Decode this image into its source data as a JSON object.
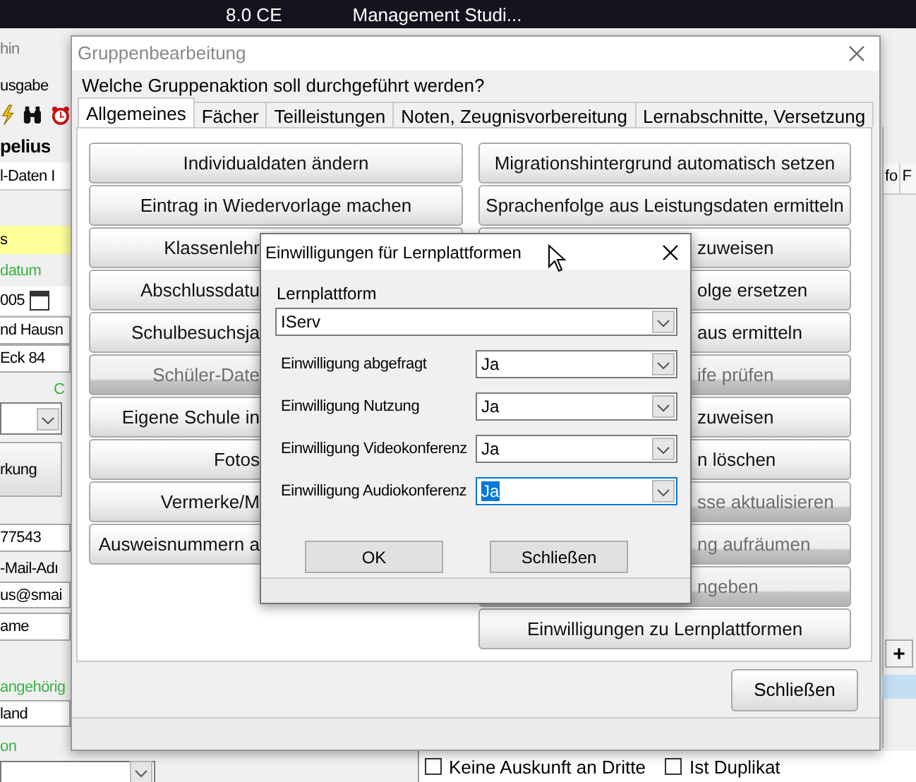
{
  "app": {
    "title_version": "8.0 CE",
    "title_app": "Management Studi...",
    "strip": [
      {
        "kind": "menu",
        "text": "hin"
      },
      {
        "kind": "text",
        "text": "usgabe"
      },
      {
        "kind": "icons"
      },
      {
        "kind": "bold",
        "text": "pelius"
      },
      {
        "kind": "tab",
        "text": "l-Daten I"
      },
      {
        "kind": "yellow",
        "text": "s"
      },
      {
        "kind": "green",
        "text": "datum"
      },
      {
        "kind": "date",
        "text": "005"
      },
      {
        "kind": "field",
        "text": "nd Hausn"
      },
      {
        "kind": "field",
        "text": "Eck 84"
      },
      {
        "kind": "greenright",
        "text": "C"
      },
      {
        "kind": "combo"
      },
      {
        "kind": "button",
        "text": "rkung"
      },
      {
        "kind": "field",
        "text": "77543"
      },
      {
        "kind": "text",
        "text": "-Mail-Adı"
      },
      {
        "kind": "field",
        "text": "us@smai"
      },
      {
        "kind": "field",
        "text": "ame"
      },
      {
        "kind": "green",
        "text": "angehörig"
      },
      {
        "kind": "field",
        "text": "land"
      },
      {
        "kind": "green",
        "text": "on"
      },
      {
        "kind": "widecombo"
      }
    ],
    "side_tabs": [
      "fo",
      "F"
    ],
    "add_button": "+",
    "checkboxes": [
      {
        "label": "Keine Auskunft an Dritte",
        "checked": false
      },
      {
        "label": "Ist Duplikat",
        "checked": false
      }
    ]
  },
  "dialog": {
    "title": "Gruppenbearbeitung",
    "prompt": "Welche Gruppenaktion soll durchgeführt werden?",
    "tabs": [
      {
        "label": "Allgemeines",
        "selected": true
      },
      {
        "label": "Fächer",
        "selected": false
      },
      {
        "label": "Teilleistungen",
        "selected": false
      },
      {
        "label": "Noten, Zeugnisvorbereitung",
        "selected": false
      },
      {
        "label": "Lernabschnitte, Versetzung",
        "selected": false
      }
    ],
    "left_buttons": [
      {
        "label": "Individualdaten ändern",
        "disabled": false
      },
      {
        "label": "Eintrag in Wiedervorlage machen",
        "disabled": false
      },
      {
        "label": "Klassenlehr",
        "disabled": false
      },
      {
        "label": "Abschlussdatu",
        "disabled": false
      },
      {
        "label": "Schulbesuchsja",
        "disabled": false
      },
      {
        "label": "Schüler-Date",
        "disabled": true
      },
      {
        "label": "Eigene Schule in",
        "disabled": false
      },
      {
        "label": "Fotos",
        "disabled": false
      },
      {
        "label": "Vermerke/M",
        "disabled": false
      },
      {
        "label": "Ausweisnummern a",
        "disabled": false
      }
    ],
    "right_buttons": [
      {
        "label": "Migrationshintergrund automatisch setzen",
        "disabled": false
      },
      {
        "label": "Sprachenfolge aus Leistungsdaten ermitteln",
        "disabled": false
      },
      {
        "label": "zuweisen",
        "disabled": false
      },
      {
        "label": "olge ersetzen",
        "disabled": false
      },
      {
        "label": "aus ermitteln",
        "disabled": false
      },
      {
        "label": "ife prüfen",
        "disabled": true
      },
      {
        "label": "zuweisen",
        "disabled": false
      },
      {
        "label": "n löschen",
        "disabled": false
      },
      {
        "label": "sse aktualisieren",
        "disabled": true
      },
      {
        "label": "ng aufräumen",
        "disabled": true
      },
      {
        "label": "ngeben",
        "disabled": true
      },
      {
        "label": "Einwilligungen zu Lernplattformen",
        "disabled": false
      }
    ],
    "close_button": "Schließen"
  },
  "consent_dialog": {
    "title": "Einwilligungen für Lernplattformen",
    "platform_label": "Lernplattform",
    "platform": "IServ",
    "rows": [
      {
        "label": "Einwilligung abgefragt",
        "value": "Ja",
        "focused": false
      },
      {
        "label": "Einwilligung Nutzung",
        "value": "Ja",
        "focused": false
      },
      {
        "label": "Einwilligung Videokonferenz",
        "value": "Ja",
        "focused": false
      },
      {
        "label": "Einwilligung Audiokonferenz",
        "value": "Ja",
        "focused": true
      }
    ],
    "ok_button": "OK",
    "close_button": "Schließen"
  }
}
